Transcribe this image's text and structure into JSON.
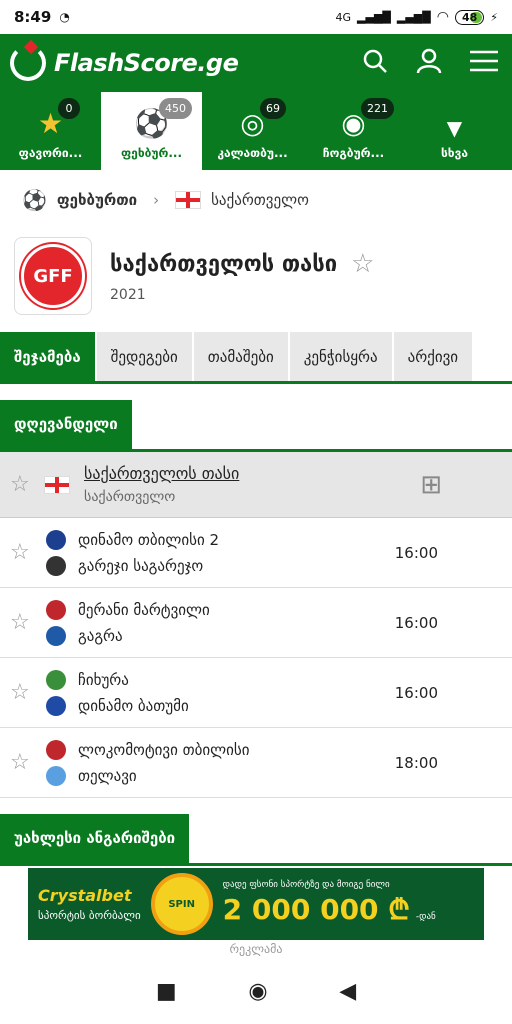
{
  "status_bar": {
    "time": "8:49",
    "network": "4G",
    "battery": "48"
  },
  "header": {
    "brand": "FlashScore.ge"
  },
  "sport_tabs": [
    {
      "label": "ფავორი...",
      "count": "0",
      "icon": "star-icon"
    },
    {
      "label": "ფეხბურ...",
      "count": "450",
      "icon": "soccer-ball-icon"
    },
    {
      "label": "კალათბუ...",
      "count": "69",
      "icon": "basketball-icon"
    },
    {
      "label": "ჩოგბურ...",
      "count": "221",
      "icon": "tennis-ball-icon"
    },
    {
      "label": "სხვა",
      "count": "",
      "icon": "chevron-down-icon"
    }
  ],
  "breadcrumb": {
    "sport": "ფეხბურთი",
    "country": "საქართველო"
  },
  "competition": {
    "title": "საქართველოს თასი",
    "year": "2021",
    "logo_text": "GFF"
  },
  "tabs": [
    "შეჯამება",
    "შედეგები",
    "თამაშები",
    "კენჭისყრა",
    "არქივი"
  ],
  "sections": {
    "today": "დღევანდელი",
    "latest_odds": "უახლესი ანგარიშები"
  },
  "league": {
    "name": "საქართველოს თასი",
    "country": "საქართველო"
  },
  "matches": [
    {
      "home": "დინამო თბილისი 2",
      "away": "გარეჯი საგარეჯო",
      "time": "16:00",
      "home_color": "#1c3f8f",
      "away_color": "#333333"
    },
    {
      "home": "მერანი მარტვილი",
      "away": "გაგრა",
      "time": "16:00",
      "home_color": "#c0272d",
      "away_color": "#1f5aa6"
    },
    {
      "home": "ჩიხურა",
      "away": "დინამო ბათუმი",
      "time": "16:00",
      "home_color": "#3a8f3a",
      "away_color": "#1f4aa6"
    },
    {
      "home": "ლოკომოტივი თბილისი",
      "away": "თელავი",
      "time": "18:00",
      "home_color": "#c0272d",
      "away_color": "#5aa0e0"
    }
  ],
  "ad": {
    "brand": "Crystalbet",
    "sub": "სპორტის ბორბალი",
    "headline": "დადე ფსონი სპორტზე და მოიგე ნილი",
    "amount": "2 000 000 ₾",
    "suffix": "-დან",
    "label": "რეკლამა"
  }
}
